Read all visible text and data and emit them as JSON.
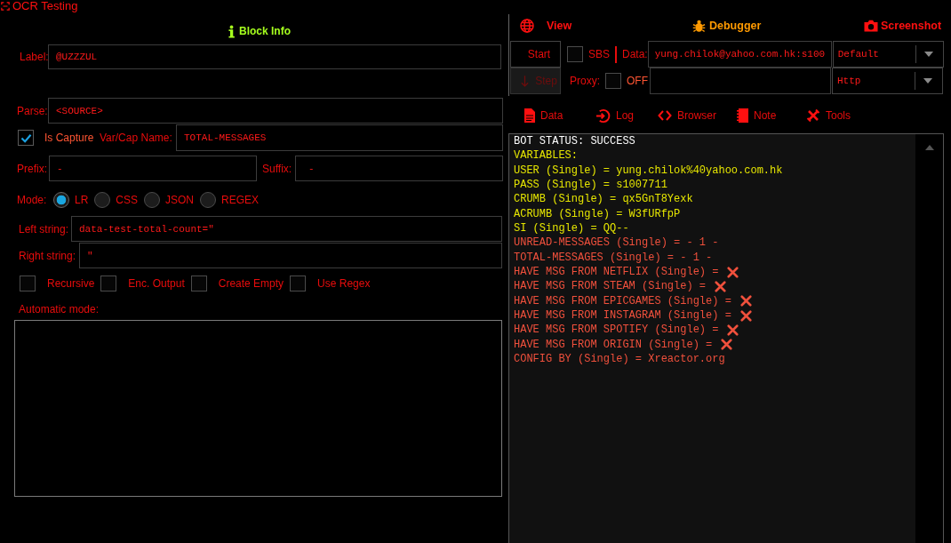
{
  "window": {
    "title": "OCR Testing"
  },
  "block_info": {
    "title": "Block Info"
  },
  "form": {
    "label": {
      "label": "Label:",
      "value": "@UZZZUL"
    },
    "parse": {
      "label": "Parse:",
      "value": "<SOURCE>"
    },
    "is_capture": {
      "label": "Is Capture",
      "checked": true
    },
    "var_cap_name": {
      "label": "Var/Cap Name:",
      "value": "TOTAL-MESSAGES"
    },
    "prefix": {
      "label": "Prefix:",
      "value": "-"
    },
    "suffix": {
      "label": "Suffix:",
      "value": "-"
    },
    "mode": {
      "label": "Mode:",
      "options": [
        {
          "label": "LR",
          "selected": true
        },
        {
          "label": "CSS",
          "selected": false
        },
        {
          "label": "JSON",
          "selected": false
        },
        {
          "label": "REGEX",
          "selected": false
        }
      ]
    },
    "left_string": {
      "label": "Left string:",
      "value": "data-test-total-count=\""
    },
    "right_string": {
      "label": "Right string:",
      "value": "\""
    },
    "options": [
      {
        "label": "Recursive",
        "checked": false
      },
      {
        "label": "Enc. Output",
        "checked": false
      },
      {
        "label": "Create Empty",
        "checked": false
      },
      {
        "label": "Use Regex",
        "checked": false
      }
    ],
    "automatic_mode": {
      "label": "Automatic mode:"
    }
  },
  "debugger": {
    "header": [
      {
        "kind": "view",
        "label": "View"
      },
      {
        "kind": "debugger",
        "label": "Debugger"
      },
      {
        "kind": "screenshot",
        "label": "Screenshot"
      }
    ],
    "start_button": {
      "label": "Start",
      "disabled": false
    },
    "step_button": {
      "label": "Step",
      "disabled": true
    },
    "sbs": {
      "label": "SBS",
      "checked": false
    },
    "data": {
      "label": "Data:",
      "value": "yung.chilok@yahoo.com.hk:s100"
    },
    "data_type": {
      "value": "Default"
    },
    "proxy": {
      "label": "Proxy:",
      "checked": false,
      "status": "OFF"
    },
    "proxy_type": {
      "value": "Http"
    },
    "tabs": [
      {
        "kind": "data",
        "label": "Data"
      },
      {
        "kind": "log",
        "label": "Log"
      },
      {
        "kind": "browser",
        "label": "Browser"
      },
      {
        "kind": "note",
        "label": "Note"
      },
      {
        "kind": "tools",
        "label": "Tools"
      }
    ],
    "output": {
      "lines": [
        {
          "text": "BOT STATUS: SUCCESS",
          "color": "#ffffff",
          "cross": false
        },
        {
          "text": "VARIABLES:",
          "color": "#e6e600",
          "cross": false
        },
        {
          "text": "USER (Single) = yung.chilok%40yahoo.com.hk",
          "color": "#e6e600",
          "cross": false
        },
        {
          "text": "PASS (Single) = s1007711",
          "color": "#e6e600",
          "cross": false
        },
        {
          "text": "CRUMB (Single) = qx5GnT8Yexk",
          "color": "#e6e600",
          "cross": false
        },
        {
          "text": "ACRUMB (Single) = W3fURfpP",
          "color": "#e6e600",
          "cross": false
        },
        {
          "text": "SI (Single) = QQ--",
          "color": "#e6e600",
          "cross": false
        },
        {
          "text": "UNREAD-MESSAGES (Single) = - 1 -",
          "color": "#f0503c",
          "cross": false
        },
        {
          "text": "TOTAL-MESSAGES (Single) = - 1 -",
          "color": "#f0503c",
          "cross": false
        },
        {
          "text": "HAVE MSG FROM NETFLIX (Single) =",
          "color": "#f0503c",
          "cross": true
        },
        {
          "text": "HAVE MSG FROM STEAM (Single) =",
          "color": "#f0503c",
          "cross": true
        },
        {
          "text": "HAVE MSG FROM EPICGAMES (Single) =",
          "color": "#f0503c",
          "cross": true
        },
        {
          "text": "HAVE MSG FROM INSTAGRAM (Single) =",
          "color": "#f0503c",
          "cross": true
        },
        {
          "text": "HAVE MSG FROM SPOTIFY (Single) =",
          "color": "#f0503c",
          "cross": true
        },
        {
          "text": "HAVE MSG FROM ORIGIN (Single) =",
          "color": "#f0503c",
          "cross": true
        },
        {
          "text": "CONFIG BY (Single) = Xreactor.org",
          "color": "#f0503c",
          "cross": false
        }
      ]
    }
  }
}
